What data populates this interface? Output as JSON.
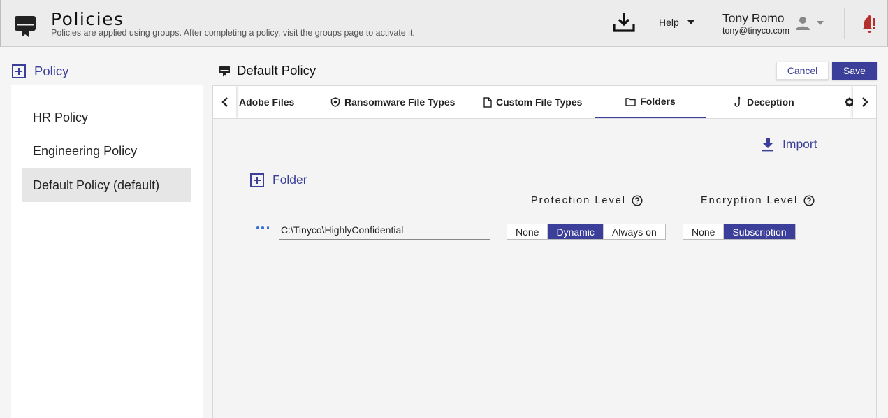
{
  "header": {
    "title": "Policies",
    "subtitle": "Policies are applied using groups. After completing a policy, visit the groups page to activate it.",
    "app_icon": "policy-badge-icon",
    "download_icon": "download-icon",
    "help_label": "Help",
    "user_name": "Tony Romo",
    "user_email": "tony@tinyco.com",
    "avatar_icon": "person-icon",
    "notification_icon": "bell-alert-icon"
  },
  "sidebar": {
    "add_label": "Policy",
    "items": [
      {
        "label": "HR Policy",
        "active": false
      },
      {
        "label": "Engineering Policy",
        "active": false
      },
      {
        "label": "Default Policy (default)",
        "active": true
      }
    ]
  },
  "main": {
    "policy_title": "Default Policy",
    "cancel_label": "Cancel",
    "save_label": "Save",
    "tabs": [
      {
        "label": "Adobe Files",
        "icon": "none",
        "active": false
      },
      {
        "label": "Ransomware File Types",
        "icon": "shield-icon",
        "active": false
      },
      {
        "label": "Custom File Types",
        "icon": "file-icon",
        "active": false
      },
      {
        "label": "Folders",
        "icon": "folder-icon",
        "active": true
      },
      {
        "label": "Deception",
        "icon": "hook-icon",
        "active": false
      }
    ],
    "import_label": "Import",
    "add_folder_label": "Folder",
    "protection_header": "Protection Level",
    "encryption_header": "Encryption Level",
    "folder_rows": [
      {
        "path": "C:\\Tinyco\\HighlyConfidential",
        "protection_options": [
          "None",
          "Dynamic",
          "Always on"
        ],
        "protection_selected": "Dynamic",
        "encryption_options": [
          "None",
          "Subscription"
        ],
        "encryption_selected": "Subscription"
      }
    ]
  },
  "colors": {
    "accent": "#3b3f99",
    "alert": "#b5302a"
  }
}
